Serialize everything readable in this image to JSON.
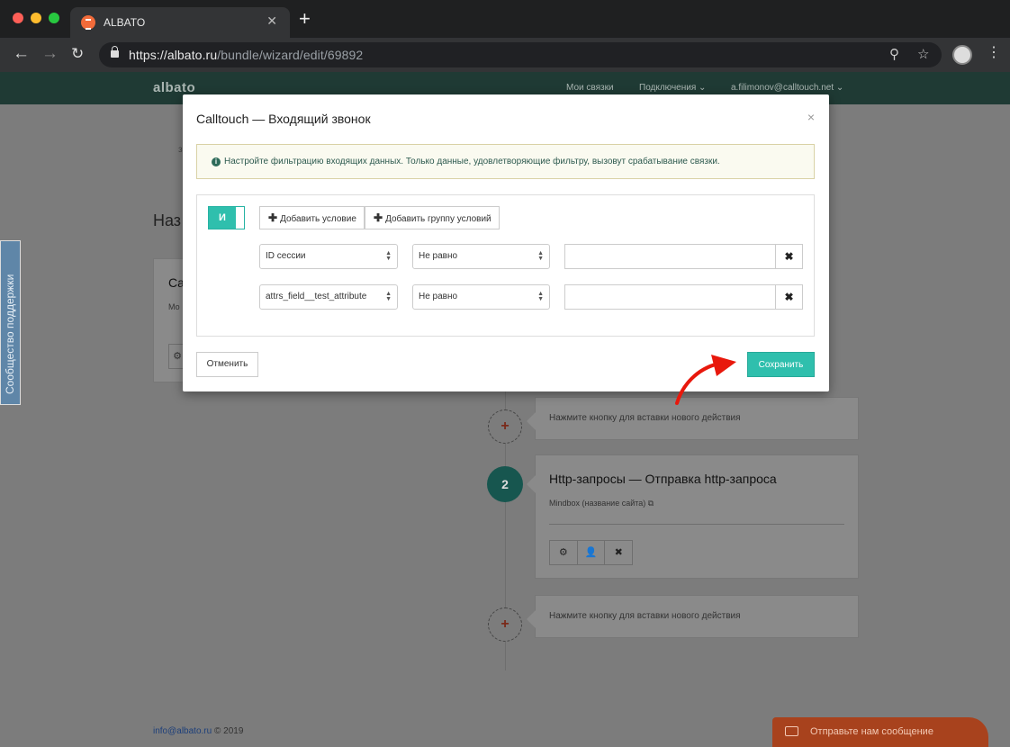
{
  "browser": {
    "tab_title": "ALBATO",
    "url_host": "https://albato.ru",
    "url_path": "/bundle/wizard/edit/69892"
  },
  "site": {
    "logo": "albato",
    "nav": [
      "Мои связки",
      "Подключения",
      "a.filimonov@calltouch.net"
    ],
    "page_title_fragment": "Наз",
    "left_fragment": "з",
    "footer_email": "info@albato.ru",
    "footer_year": "© 2019",
    "support_tab": "Сообщество поддержки",
    "chat_button": "Отправьте нам сообщение"
  },
  "steps": {
    "insert_label": "Нажмите кнопку для вставки нового действия",
    "plus": "+",
    "action": {
      "number": "2",
      "title": "Http-запросы — Отправка http-запроса",
      "subtitle": "Mindbox (название сайта)"
    },
    "bg_card": {
      "title_fragment": "Ca",
      "sub_fragment": "Мо"
    }
  },
  "modal": {
    "title": "Calltouch — Входящий звонок",
    "close": "×",
    "alert_icon": "i",
    "alert_text": "Настройте фильтрацию входящих данных. Только данные, удовлетворяющие фильтру, вызовут срабатывание связки.",
    "toggle_label": "И",
    "add_condition": "Добавить условие",
    "add_group": "Добавить группу условий",
    "conditions": [
      {
        "field": "ID сессии",
        "operator": "Не равно",
        "value": ""
      },
      {
        "field": "attrs_field__test_attribute",
        "operator": "Не равно",
        "value": ""
      }
    ],
    "cancel_label": "Отменить",
    "save_label": "Сохранить"
  },
  "colors": {
    "accent": "#2fbfad",
    "header_bg": "#1f3a34",
    "arrow": "#e8180c",
    "chat": "#a8421d"
  }
}
